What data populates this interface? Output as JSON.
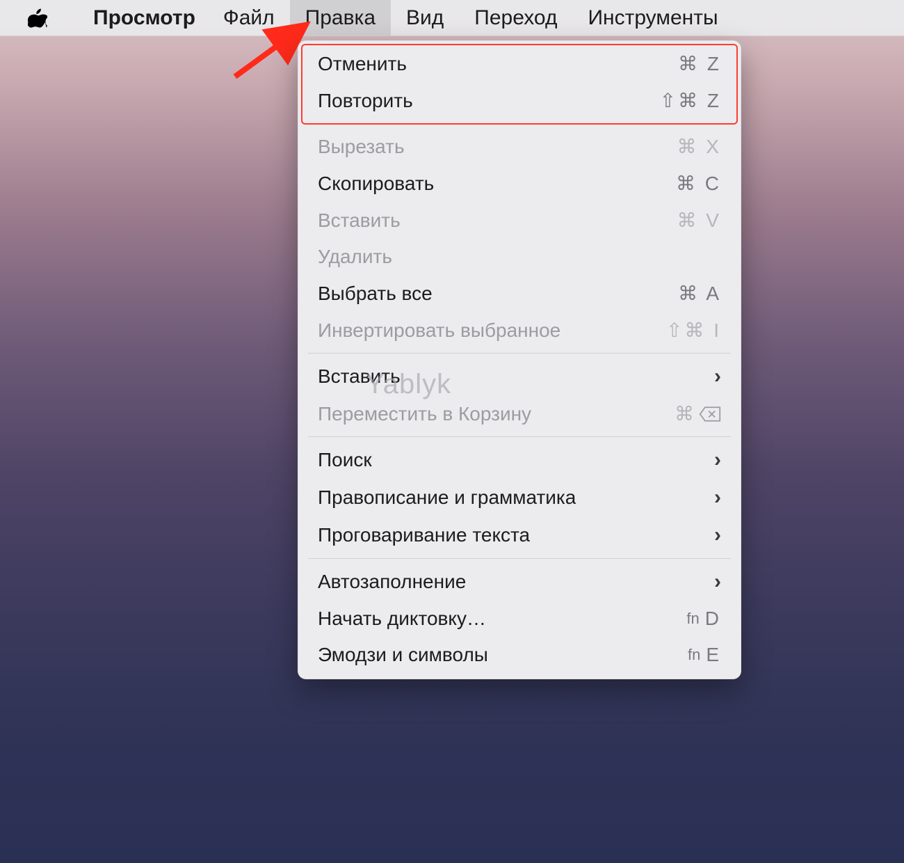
{
  "menubar": {
    "app_name": "Просмотр",
    "items": [
      {
        "label": "Файл",
        "active": false
      },
      {
        "label": "Правка",
        "active": true
      },
      {
        "label": "Вид",
        "active": false
      },
      {
        "label": "Переход",
        "active": false
      },
      {
        "label": "Инструменты",
        "active": false
      }
    ]
  },
  "watermark": "Yablyk",
  "dropdown": {
    "groups": [
      [
        {
          "label": "Отменить",
          "shortcut": "⌘ Z",
          "disabled": false,
          "highlighted": true
        },
        {
          "label": "Повторить",
          "shortcut": "⇧⌘ Z",
          "disabled": false,
          "highlighted": true
        }
      ],
      [
        {
          "label": "Вырезать",
          "shortcut": "⌘ X",
          "disabled": true
        },
        {
          "label": "Скопировать",
          "shortcut": "⌘ C",
          "disabled": false
        },
        {
          "label": "Вставить",
          "shortcut": "⌘ V",
          "disabled": true
        },
        {
          "label": "Удалить",
          "shortcut": "",
          "disabled": true
        },
        {
          "label": "Выбрать все",
          "shortcut": "⌘ A",
          "disabled": false
        },
        {
          "label": "Инвертировать выбранное",
          "shortcut": "⇧⌘ I",
          "disabled": true
        }
      ],
      [
        {
          "label": "Вставить",
          "submenu": true,
          "disabled": false
        },
        {
          "label": "Переместить в Корзину",
          "shortcut": "⌘ ⌫",
          "disabled": true,
          "delete_icon": true
        }
      ],
      [
        {
          "label": "Поиск",
          "submenu": true,
          "disabled": false
        },
        {
          "label": "Правописание и грамматика",
          "submenu": true,
          "disabled": false
        },
        {
          "label": "Проговаривание текста",
          "submenu": true,
          "disabled": false
        }
      ],
      [
        {
          "label": "Автозаполнение",
          "submenu": true,
          "disabled": false
        },
        {
          "label": "Начать диктовку…",
          "shortcut_fn": "fn",
          "shortcut": "D",
          "disabled": false
        },
        {
          "label": "Эмодзи и символы",
          "shortcut_fn": "fn",
          "shortcut": "E",
          "disabled": false
        }
      ]
    ]
  }
}
